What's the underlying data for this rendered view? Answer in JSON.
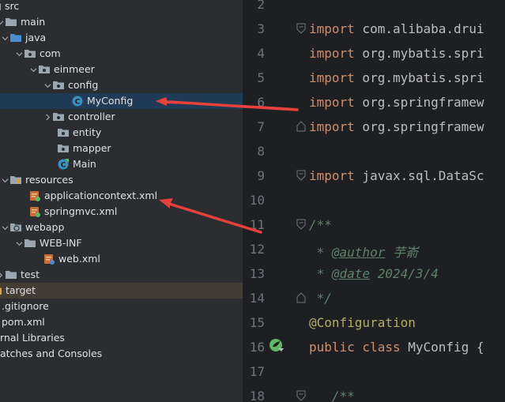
{
  "project_tree": {
    "items": [
      {
        "label": "src"
      },
      {
        "label": "main"
      },
      {
        "label": "java"
      },
      {
        "label": "com"
      },
      {
        "label": "einmeer"
      },
      {
        "label": "config"
      },
      {
        "label": "MyConfig"
      },
      {
        "label": "controller"
      },
      {
        "label": "entity"
      },
      {
        "label": "mapper"
      },
      {
        "label": "Main"
      },
      {
        "label": "resources"
      },
      {
        "label": "applicationcontext.xml"
      },
      {
        "label": "springmvc.xml"
      },
      {
        "label": "webapp"
      },
      {
        "label": "WEB-INF"
      },
      {
        "label": "web.xml"
      },
      {
        "label": "test"
      },
      {
        "label": "target"
      },
      {
        "label": ".gitignore"
      },
      {
        "label": "pom.xml"
      },
      {
        "label": "rnal Libraries"
      },
      {
        "label": "atches and Consoles"
      }
    ]
  },
  "editor": {
    "line_numbers": [
      "2",
      "3",
      "4",
      "5",
      "6",
      "7",
      "8",
      "9",
      "10",
      "11",
      "12",
      "13",
      "14",
      "15",
      "16",
      "17",
      "18"
    ],
    "lines": {
      "l3_kw": "import",
      "l3_rest": " com.alibaba.drui",
      "l4_kw": "import",
      "l4_rest": " org.mybatis.spri",
      "l5_kw": "import",
      "l5_rest": " org.mybatis.spri",
      "l6_kw": "import",
      "l6_rest": " org.springframew",
      "l7_kw": "import",
      "l7_rest": " org.springframew",
      "l9_kw": "import",
      "l9_rest": " javax.sql.DataSc",
      "l11": "/**",
      "l12_star": " * ",
      "l12_tag": "@author",
      "l12_val": " 芋嵛",
      "l13_star": " * ",
      "l13_tag": "@date",
      "l13_val": " 2024/3/4",
      "l14": " */",
      "l15": "@Configuration",
      "l16_kw1": "public",
      "l16_kw2": " class",
      "l16_rest": " MyConfig {",
      "l18": "   /**"
    }
  },
  "colors": {
    "tree_bg": "#2b2d30",
    "editor_bg": "#1e1f22",
    "selection": "#213a56",
    "arrow": "#e8403a",
    "keyword": "#cf8e6d",
    "annotation": "#b3ae60"
  },
  "icons": [
    "folder-icon",
    "package-icon",
    "class-icon",
    "main-class-icon",
    "xml-file-icon",
    "spring-bean-gutter-icon",
    "chevron-icon"
  ]
}
